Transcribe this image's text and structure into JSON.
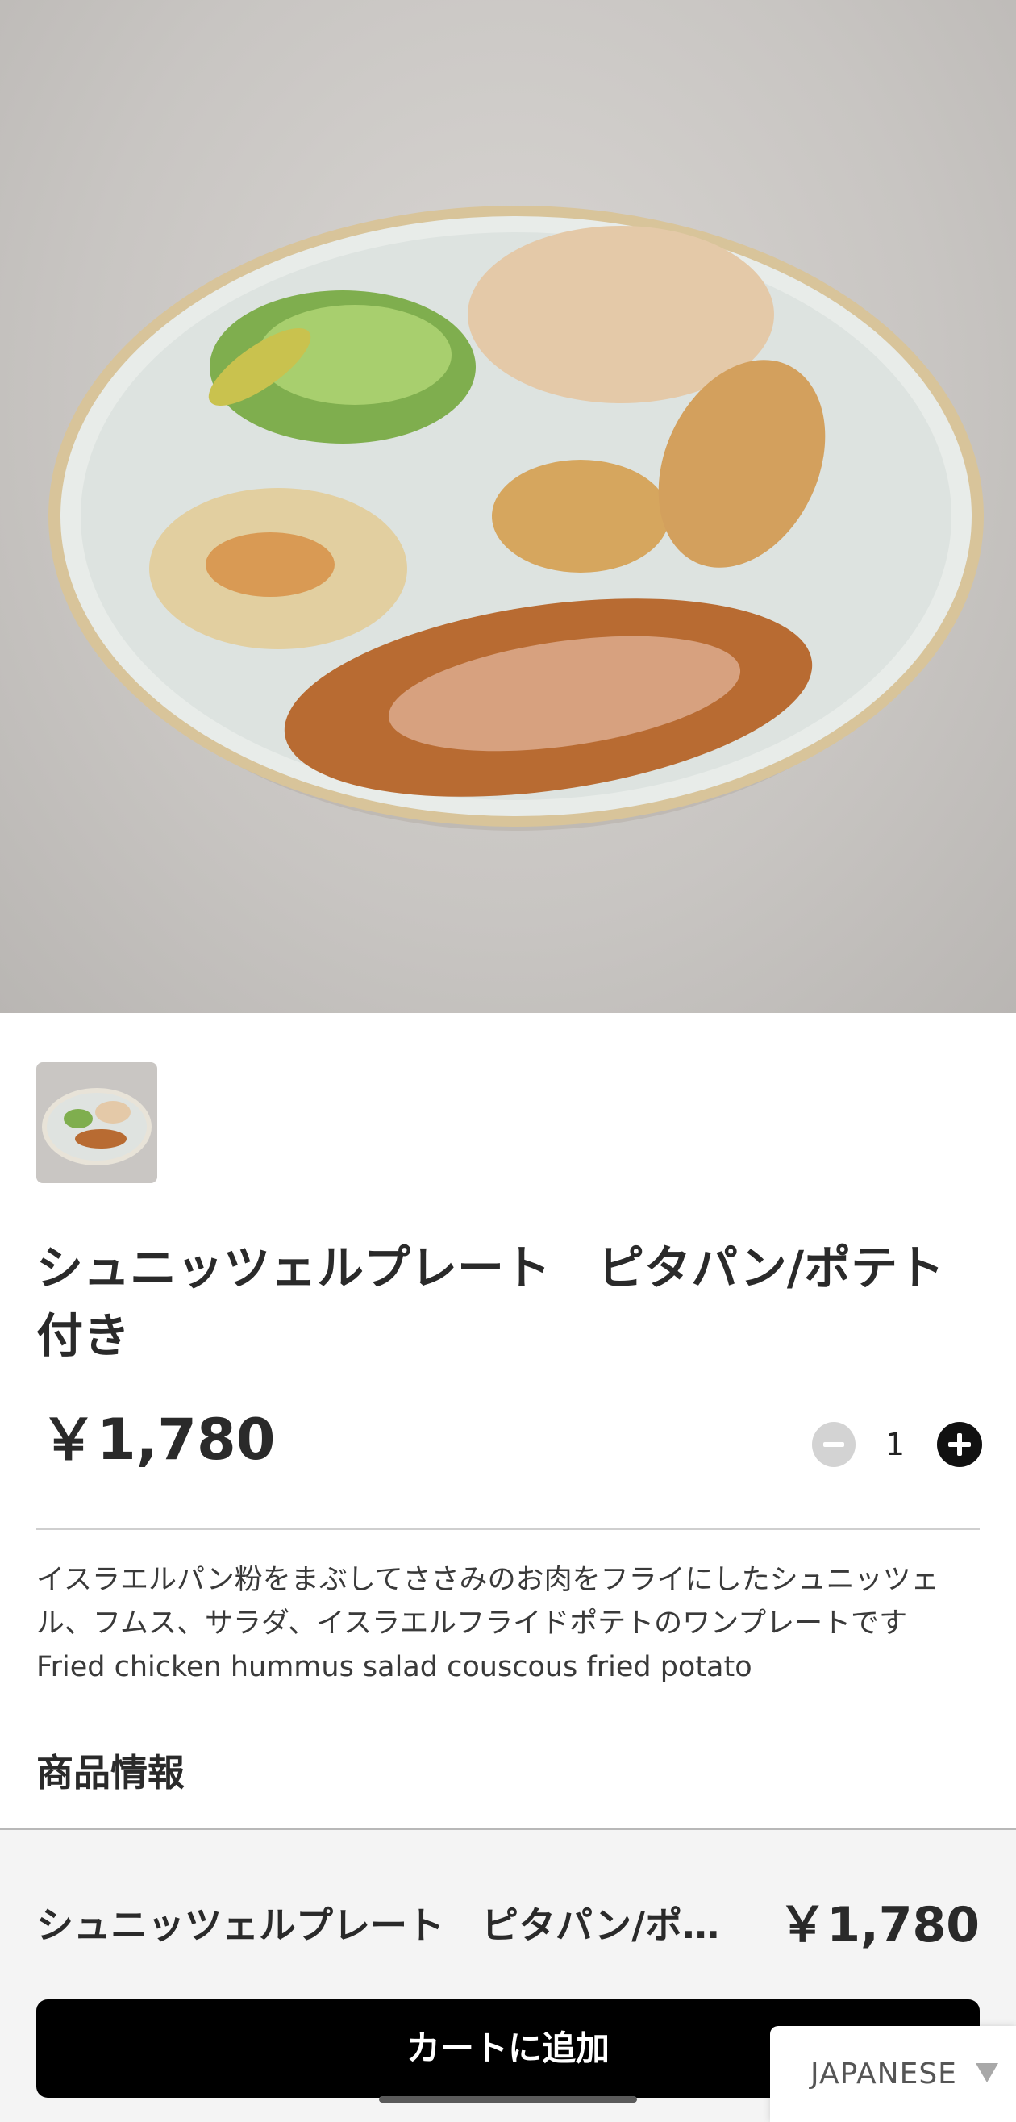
{
  "product": {
    "title": "シュニッツェルプレート　ピタパン/ポテト付き",
    "price": "￥1,780",
    "quantity": "1",
    "description_ja": "イスラエルパン粉をまぶしてささみのお肉をフライにしたシュニッツェル、フムス、サラダ、イスラエルフライドポテトのワンプレートです",
    "description_en": "Fried chicken hummus salad couscous fried potato",
    "info_heading": "商品情報"
  },
  "footer": {
    "name": "シュニッツェルプレート　ピタパン/ポテト付き",
    "price": "￥1,780",
    "add_to_cart": "カートに追加"
  },
  "language": {
    "selected": "JAPANESE"
  },
  "icons": {
    "minus": "minus-circle-icon",
    "plus": "plus-circle-icon",
    "language_caret": "caret-down-icon"
  },
  "colors": {
    "primary_button": "#000000",
    "disabled_minus": "#d3d3d3",
    "footer_bg": "#f4f4f4"
  }
}
